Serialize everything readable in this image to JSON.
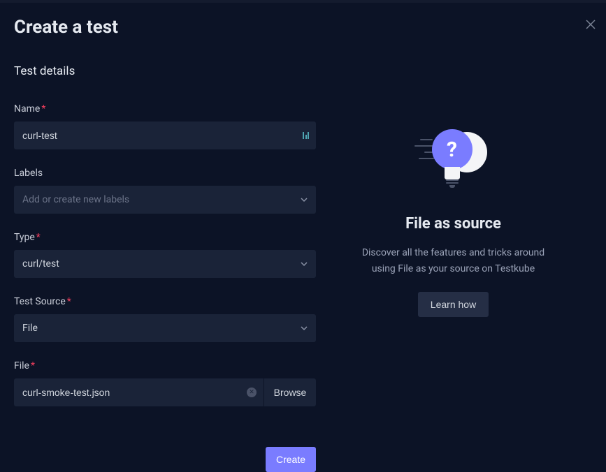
{
  "modal": {
    "title": "Create a test",
    "sectionTitle": "Test details"
  },
  "form": {
    "name": {
      "label": "Name",
      "value": "curl-test"
    },
    "labels": {
      "label": "Labels",
      "placeholder": "Add or create new labels"
    },
    "type": {
      "label": "Type",
      "value": "curl/test"
    },
    "testSource": {
      "label": "Test Source",
      "value": "File"
    },
    "file": {
      "label": "File",
      "value": "curl-smoke-test.json",
      "browseLabel": "Browse"
    },
    "createLabel": "Create"
  },
  "sidebar": {
    "title": "File as source",
    "description": "Discover all the features and tricks around using File as your source on Testkube",
    "learnLabel": "Learn how"
  }
}
